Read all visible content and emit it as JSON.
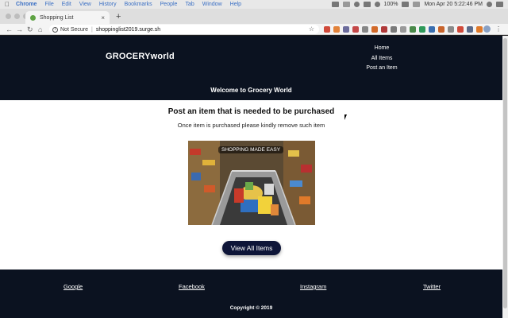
{
  "os_menubar": {
    "app_name": "Chrome",
    "menu_items": [
      "File",
      "Edit",
      "View",
      "History",
      "Bookmarks",
      "People",
      "Tab",
      "Window",
      "Help"
    ],
    "battery": "100%",
    "clock": "Mon Apr 20  5:22:46 PM"
  },
  "browser": {
    "tab_title": "Shopping List",
    "security_label": "Not Secure",
    "url": "shoppinglist2019.surge.sh"
  },
  "site": {
    "brand": "GROCERYworld",
    "nav": [
      "Home",
      "All Items",
      "Post an Item"
    ],
    "welcome": "Welcome to Grocery World",
    "heading": "Post an item that is needed to be purchased",
    "subtext": "Once item is purchased please kindly remove such item",
    "image_caption": "SHOPPING MADE EASY",
    "cta_label": "View All Items",
    "footer_links": [
      "Google",
      "Facebook",
      "Instagram",
      "Twitter"
    ],
    "copyright": "Copyright © 2019"
  }
}
